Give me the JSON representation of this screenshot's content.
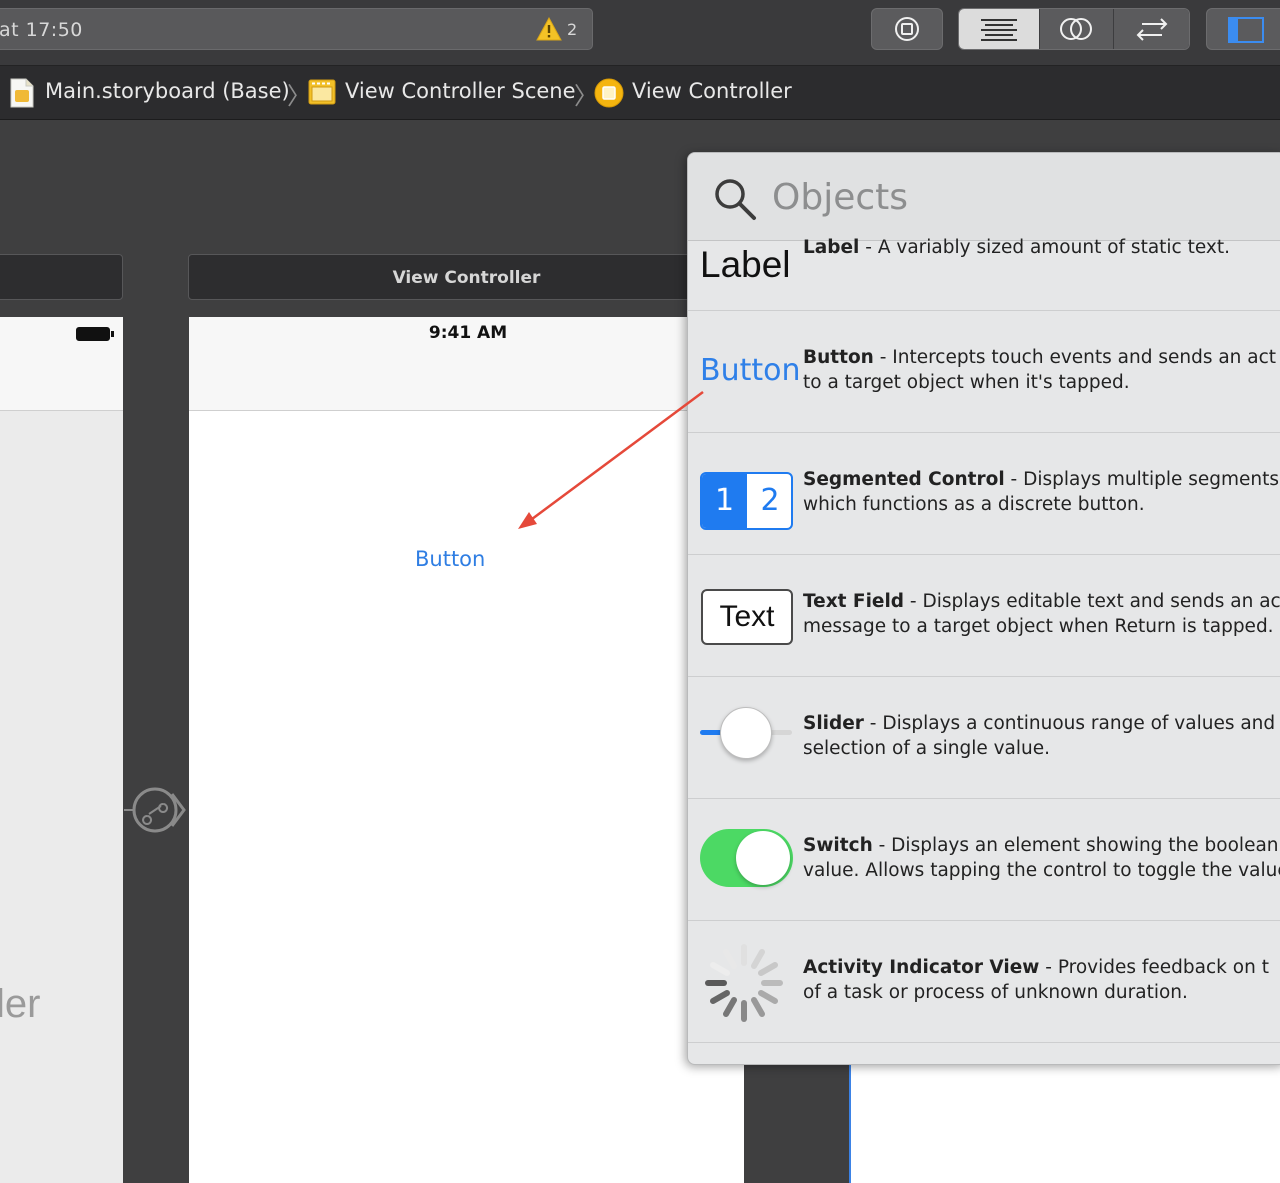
{
  "toolbar": {
    "status_text": "at 17:50",
    "warning_count": "2",
    "icons": [
      "stop-icon",
      "standard-editor-icon",
      "assistant-editor-icon",
      "version-editor-icon",
      "navigator-toggle-icon",
      "warning-icon"
    ],
    "colors": {
      "toolbar_bg": "#3a3a3c",
      "button_bg": "#5b5b5d",
      "selected_bg": "#dcdcdc",
      "accent": "#3b82e6"
    }
  },
  "jumpbar": {
    "items": [
      {
        "label": "Main.storyboard (Base)",
        "icon": "storyboard-file-icon"
      },
      {
        "label": "View Controller Scene",
        "icon": "scene-icon"
      },
      {
        "label": "View Controller",
        "icon": "view-controller-icon"
      }
    ]
  },
  "canvas": {
    "left_scene_text": "ler",
    "view_controller_title": "View Controller",
    "status_time": "9:41 AM",
    "button_label": "Button",
    "segue_icon": "segue-icon"
  },
  "library": {
    "search_placeholder": "Objects",
    "items": [
      {
        "thumb": "Label",
        "name": "Label",
        "desc_line1": " - A variably sized amount of static text.",
        "desc_line2": ""
      },
      {
        "thumb": "Button",
        "name": "Button",
        "desc_line1": " - Intercepts touch events and sends an act",
        "desc_line2": "to a target object when it's tapped."
      },
      {
        "thumb_1": "1",
        "thumb_2": "2",
        "name": "Segmented Control",
        "desc_line1": " - Displays multiple segments",
        "desc_line2": "which functions as a discrete button."
      },
      {
        "thumb": "Text",
        "name": "Text Field",
        "desc_line1": " - Displays editable text and sends an ac",
        "desc_line2": "message to a target object when Return is tapped."
      },
      {
        "thumb": "",
        "name": "Slider",
        "desc_line1": " - Displays a continuous range of values and",
        "desc_line2": "selection of a single value."
      },
      {
        "thumb": "",
        "name": "Switch",
        "desc_line1": " - Displays an element showing the boolean",
        "desc_line2": "value. Allows tapping the control to toggle the value"
      },
      {
        "thumb": "",
        "name": "Activity Indicator View",
        "desc_line1": " - Provides feedback on t",
        "desc_line2": "of a task or process of unknown duration."
      }
    ],
    "slider_value": 0.25,
    "switch_on": true,
    "colors": {
      "ios_blue": "#1f7bf0",
      "switch_green": "#4cd964",
      "annotation_arrow": "#e5493a"
    }
  }
}
